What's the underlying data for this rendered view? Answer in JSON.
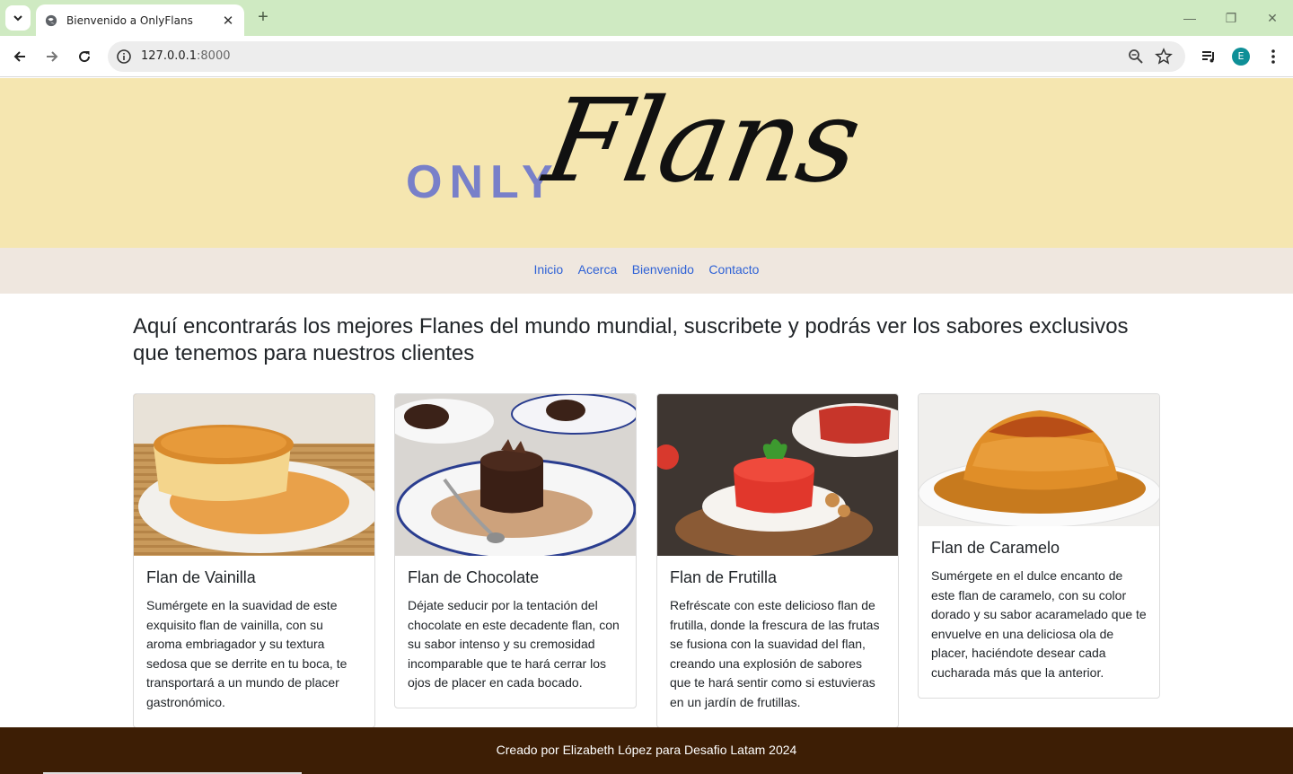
{
  "browser": {
    "tab_title": "Bienvenido a OnlyFlans",
    "url_host": "127.0.0.1",
    "url_port": ":8000",
    "profile_initial": "E"
  },
  "header": {
    "logo_only": "ONLY",
    "logo_flans": "Flans"
  },
  "nav": {
    "items": [
      "Inicio",
      "Acerca",
      "Bienvenido",
      "Contacto"
    ]
  },
  "intro": "Aquí encontrarás los mejores Flanes del mundo mundial, suscribete y podrás ver los sabores exclusivos que tenemos para nuestros clientes",
  "cards": [
    {
      "title": "Flan de Vainilla",
      "text": "Sumérgete en la suavidad de este exquisito flan de vainilla, con su aroma embriagador y su textura sedosa que se derrite en tu boca, te transportará a un mundo de placer gastronómico."
    },
    {
      "title": "Flan de Chocolate",
      "text": "Déjate seducir por la tentación del chocolate en este decadente flan, con su sabor intenso y su cremosidad incomparable que te hará cerrar los ojos de placer en cada bocado."
    },
    {
      "title": "Flan de Frutilla",
      "text": "Refréscate con este delicioso flan de frutilla, donde la frescura de las frutas se fusiona con la suavidad del flan, creando una explosión de sabores que te hará sentir como si estuvieras en un jardín de frutillas."
    },
    {
      "title": "Flan de Caramelo",
      "text": "Sumérgete en el dulce encanto de este flan de caramelo, con su color dorado y su sabor acaramelado que te envuelve en una deliciosa ola de placer, haciéndote desear cada cucharada más que la anterior."
    }
  ],
  "footer": "Creado por Elizabeth López para Desafio Latam 2024"
}
